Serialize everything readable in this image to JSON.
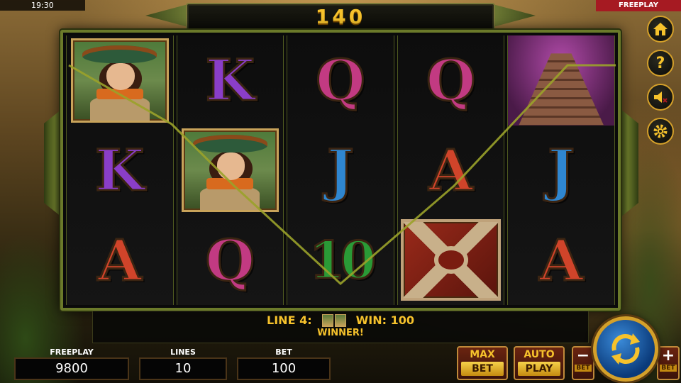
{
  "status_bar": {
    "time": "19:30",
    "mode": "FREEPLAY"
  },
  "total_win": "140",
  "reels": [
    [
      "explorer",
      "K",
      "A"
    ],
    [
      "K",
      "explorer",
      "Q"
    ],
    [
      "Q",
      "J",
      "10"
    ],
    [
      "Q",
      "A",
      "chest"
    ],
    [
      "pyramid",
      "J",
      "A"
    ]
  ],
  "win_message": {
    "line_label": "LINE 4:",
    "win_label": "WIN: 100",
    "status": "WINNER!",
    "payline_color": "#9aa22a"
  },
  "bottom_panel": {
    "credit": {
      "label": "FREEPLAY",
      "value": "9800"
    },
    "lines": {
      "label": "LINES",
      "value": "10"
    },
    "bet": {
      "label": "BET",
      "value": "100"
    },
    "max_bet": {
      "top": "MAX",
      "bottom": "BET"
    },
    "auto_play": {
      "top": "AUTO",
      "bottom": "PLAY"
    },
    "bet_minus": {
      "sign": "−",
      "caption": "BET"
    },
    "bet_plus": {
      "sign": "+",
      "caption": "BET"
    }
  },
  "side_menu": [
    {
      "name": "home-icon"
    },
    {
      "name": "help-icon",
      "glyph": "?"
    },
    {
      "name": "sound-off-icon"
    },
    {
      "name": "settings-icon"
    }
  ],
  "colors": {
    "accent_gold": "#f6c22c",
    "frame_green": "#6b7a2a",
    "freeplay_red": "#a61a22",
    "spin_blue": "#1a5aa8"
  }
}
